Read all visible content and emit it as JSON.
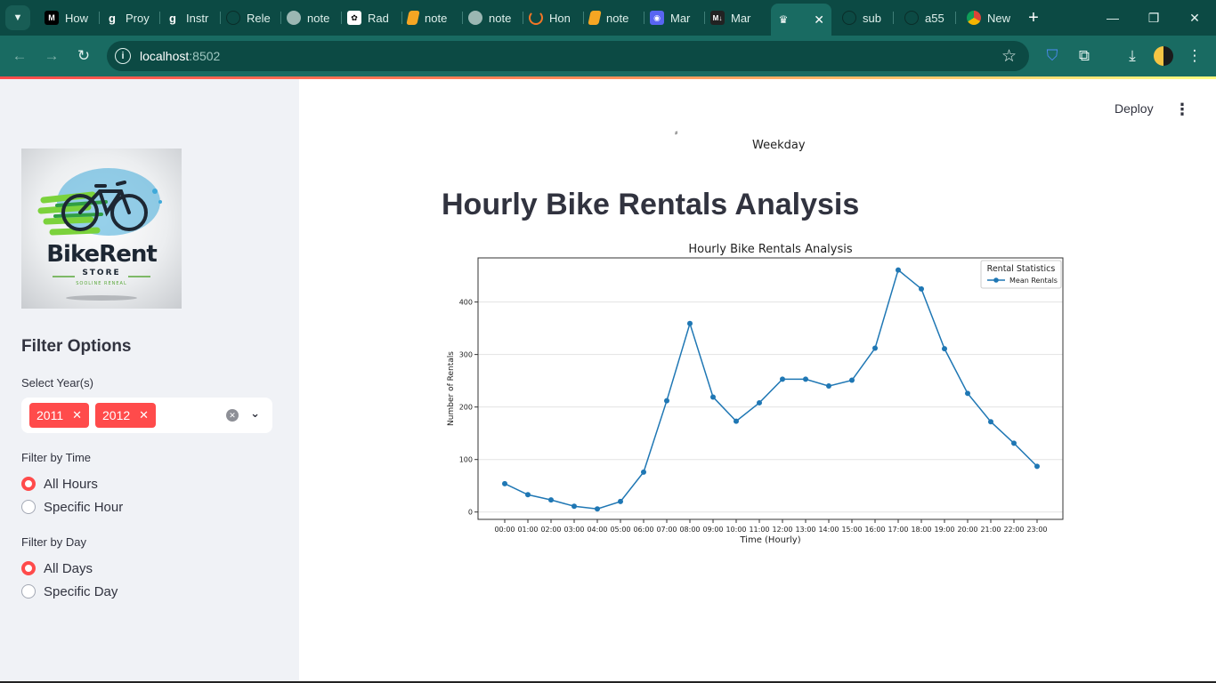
{
  "browser": {
    "tabs": [
      {
        "label": "How",
        "favicon": "M"
      },
      {
        "label": "Proy",
        "favicon": "g"
      },
      {
        "label": "Instr",
        "favicon": "g"
      },
      {
        "label": "Rele",
        "favicon": "github"
      },
      {
        "label": "note",
        "favicon": "globe"
      },
      {
        "label": "Rad",
        "favicon": "openai"
      },
      {
        "label": "note",
        "favicon": "book"
      },
      {
        "label": "note",
        "favicon": "globe"
      },
      {
        "label": "Hon",
        "favicon": "jupyter"
      },
      {
        "label": "note",
        "favicon": "book"
      },
      {
        "label": "Mar",
        "favicon": "discord"
      },
      {
        "label": "Mar",
        "favicon": "M"
      },
      {
        "label": "",
        "favicon": "streamlit",
        "active": true
      },
      {
        "label": "sub",
        "favicon": "github"
      },
      {
        "label": "a55",
        "favicon": "github"
      },
      {
        "label": "New",
        "favicon": "chrome"
      }
    ],
    "url_host": "localhost",
    "url_port": ":8502"
  },
  "sidebar": {
    "logo": {
      "title": "BikeRent",
      "store": "STORE",
      "tagline": "SOOLINE RENEAL"
    },
    "heading": "Filter Options",
    "year_label": "Select Year(s)",
    "years": [
      "2011",
      "2012"
    ],
    "time_label": "Filter by Time",
    "time_options": [
      "All Hours",
      "Specific Hour"
    ],
    "time_selected": 0,
    "day_label": "Filter by Day",
    "day_options": [
      "All Days",
      "Specific Day"
    ],
    "day_selected": 0
  },
  "header": {
    "deploy_label": "Deploy"
  },
  "main": {
    "upper_chart_xlabel": "Weekday",
    "title": "Hourly Bike Rentals Analysis"
  },
  "chart_data": {
    "type": "line",
    "title": "Hourly Bike Rentals Analysis",
    "xlabel": "Time (Hourly)",
    "ylabel": "Number of Rentals",
    "categories": [
      "00:00",
      "01:00",
      "02:00",
      "03:00",
      "04:00",
      "05:00",
      "06:00",
      "07:00",
      "08:00",
      "09:00",
      "10:00",
      "11:00",
      "12:00",
      "13:00",
      "14:00",
      "15:00",
      "16:00",
      "17:00",
      "18:00",
      "19:00",
      "20:00",
      "21:00",
      "22:00",
      "23:00"
    ],
    "series": [
      {
        "name": "Mean Rentals",
        "color": "#1f77b4",
        "values": [
          54,
          33,
          23,
          11,
          6,
          20,
          76,
          212,
          359,
          219,
          173,
          208,
          253,
          253,
          240,
          251,
          312,
          461,
          425,
          311,
          226,
          172,
          131,
          87
        ]
      }
    ],
    "legend_title": "Rental Statistics",
    "legend_position": "top-right",
    "ylim": [
      -14,
      484
    ],
    "yticks": [
      0,
      100,
      200,
      300,
      400
    ],
    "grid": "horizontal"
  }
}
